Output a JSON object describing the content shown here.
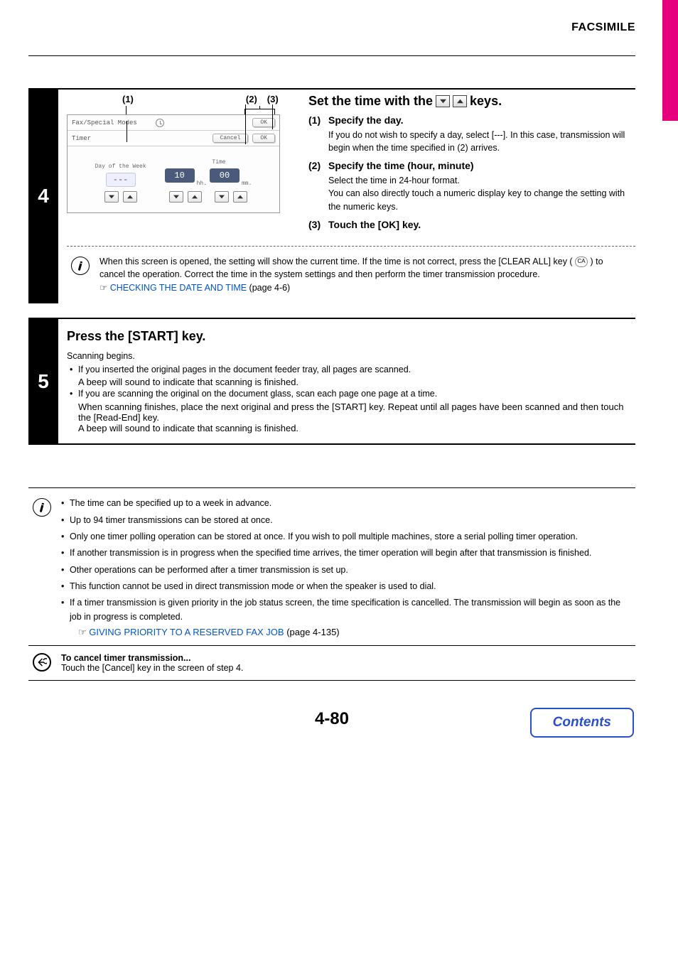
{
  "header": "FACSIMILE",
  "step4": {
    "num": "4",
    "callouts": [
      "(1)",
      "(2)",
      "(3)"
    ],
    "panel": {
      "row1_label": "Fax/Special Modes",
      "row1_ok": "OK",
      "row2_label": "Timer",
      "row2_cancel": "Cancel",
      "row2_ok": "OK",
      "day_label": "Day of the Week",
      "time_label": "Time",
      "day_value": "---",
      "hour_value": "10",
      "min_value": "00",
      "hh": "hh.",
      "mm": "mm."
    },
    "title_a": "Set the time with the ",
    "title_b": " keys.",
    "items": [
      {
        "num": "(1)",
        "head": "Specify the day.",
        "body": "If you do not wish to specify a day, select [---]. In this case, transmission will begin when the time specified in (2) arrives."
      },
      {
        "num": "(2)",
        "head": "Specify the time (hour, minute)",
        "body1": "Select the time in 24-hour format.",
        "body2": "You can also directly touch a numeric display key to change the setting with the numeric keys."
      },
      {
        "num": "(3)",
        "head": "Touch the [OK] key."
      }
    ],
    "note": {
      "line1": "When this screen is opened, the setting will show the current time. If the time is not correct, press the [CLEAR ALL] key (",
      "line2": ") to cancel the operation. Correct the time in the system settings and then perform the timer transmission procedure.",
      "ca": "CA",
      "link": "CHECKING THE DATE AND TIME",
      "pageref": " (page 4-6)"
    }
  },
  "step5": {
    "num": "5",
    "title": "Press the [START] key.",
    "intro": "Scanning begins.",
    "b1a": "If you inserted the original pages in the document feeder tray, all pages are scanned.",
    "b1b": "A beep will sound to indicate that scanning is finished.",
    "b2a": "If you are scanning the original on the document glass, scan each page one page at a time.",
    "b2b": "When scanning finishes, place the next original and press the [START] key. Repeat until all pages have been scanned and then touch the [Read-End] key.",
    "b2c": "A beep will sound to indicate that scanning is finished."
  },
  "notes": {
    "items": [
      "The time can be specified up to a week in advance.",
      "Up to 94 timer transmissions can be stored at once.",
      "Only one timer polling operation can be stored at once. If you wish to poll multiple machines, store a serial polling timer operation.",
      "If another transmission is in progress when the specified time arrives, the timer operation will begin after that transmission is finished.",
      "Other operations can be performed after a timer transmission is set up.",
      "This function cannot be used in direct transmission mode or when the speaker is used to dial.",
      "If a timer transmission is given priority in the job status screen, the time specification is cancelled. The transmission will begin as soon as the job in progress is completed."
    ],
    "link": "GIVING PRIORITY TO A RESERVED FAX JOB",
    "link_pageref": " (page 4-135)"
  },
  "cancel": {
    "head": "To cancel timer transmission...",
    "body": "Touch the [Cancel] key in the screen of step 4."
  },
  "page_num": "4-80",
  "contents": "Contents"
}
